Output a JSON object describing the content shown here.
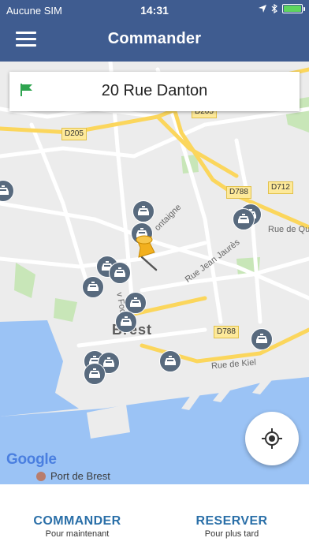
{
  "status_bar": {
    "carrier": "Aucune SIM",
    "time": "14:31"
  },
  "header": {
    "title": "Commander"
  },
  "address": {
    "value": "20 Rue Danton"
  },
  "map": {
    "road_labels": [
      "D205",
      "D205",
      "D788",
      "D712",
      "D788"
    ],
    "streets": [
      "Rue de Quin",
      "Rue Jean Jaurès",
      "ontaigne",
      "Rue de Kiel",
      "v Foc"
    ],
    "city": "Brest",
    "attribution": "Google",
    "poi": "Port de Brest"
  },
  "actions": {
    "order_now_label": "COMMANDER",
    "order_now_sub": "Pour maintenant",
    "book_label": "RESERVER",
    "book_sub": "Pour plus tard"
  },
  "colors": {
    "header_bg": "#3f5c90",
    "accent": "#2a6fa8",
    "taxi_marker": "#586a7e",
    "pin": "#f2b01e",
    "flag": "#2ea44f"
  }
}
